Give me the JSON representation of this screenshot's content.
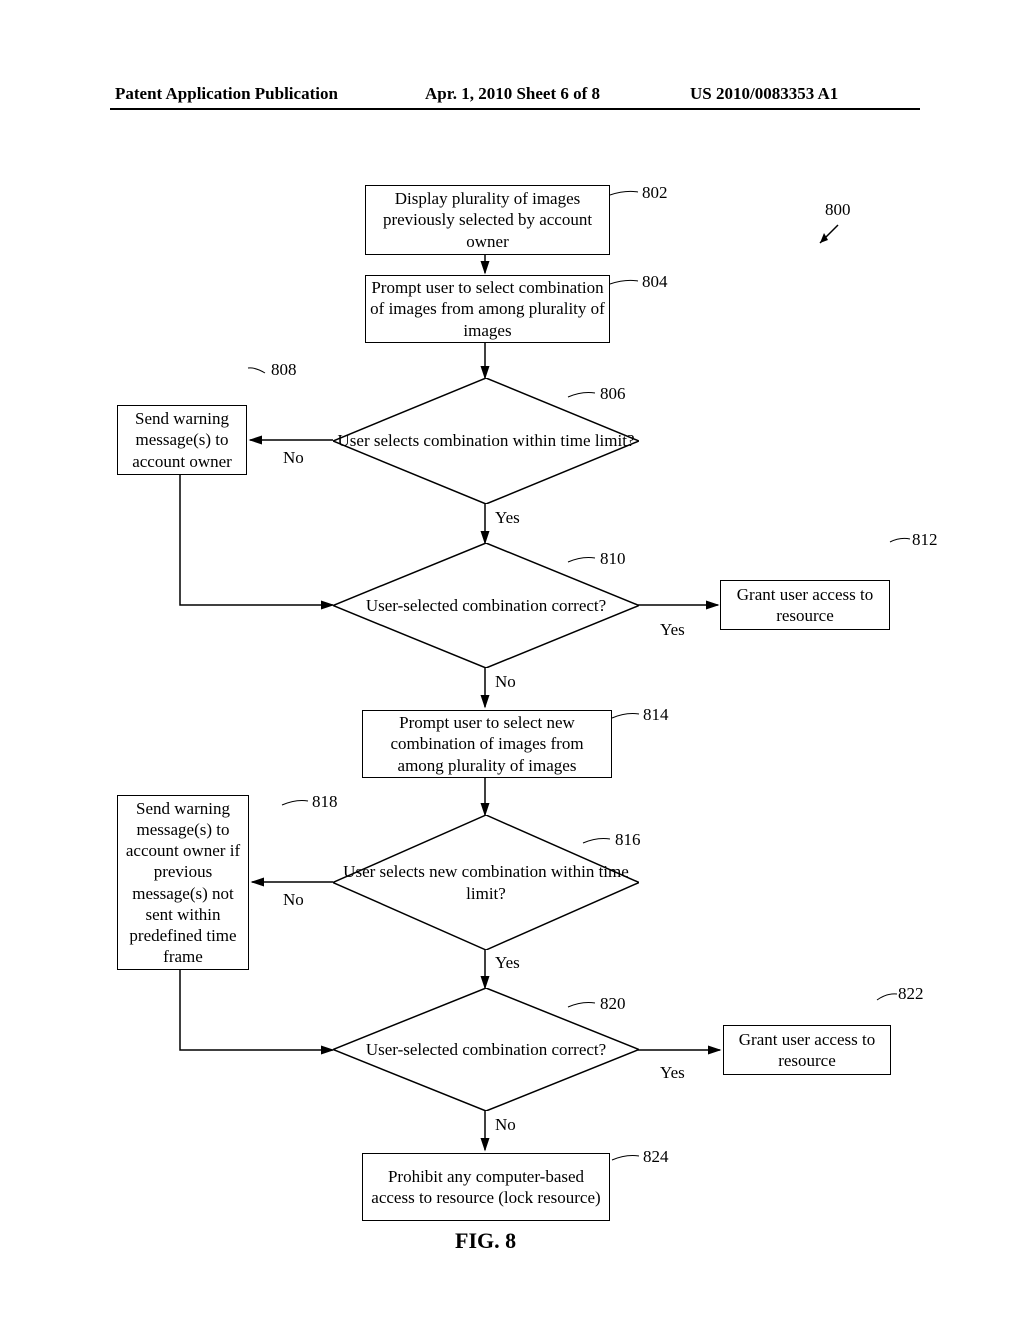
{
  "header": {
    "left": "Patent Application Publication",
    "center": "Apr. 1, 2010  Sheet 6 of 8",
    "right": "US 2010/0083353 A1"
  },
  "refs": {
    "r800": "800",
    "r802": "802",
    "r804": "804",
    "r806": "806",
    "r808": "808",
    "r810": "810",
    "r812": "812",
    "r814": "814",
    "r816": "816",
    "r818": "818",
    "r820": "820",
    "r822": "822",
    "r824": "824"
  },
  "boxes": {
    "b802": "Display plurality of images previously selected by account owner",
    "b804": "Prompt user to select combination of images from among plurality of images",
    "b808": "Send warning message(s) to account owner",
    "b812": "Grant user access to resource",
    "b814": "Prompt user to select new combination of images from among plurality of images",
    "b818": "Send warning message(s) to account owner if previous message(s) not sent within predefined time frame",
    "b822": "Grant user access to resource",
    "b824": "Prohibit any computer-based access to resource (lock resource)"
  },
  "diamonds": {
    "d806": "User selects combination within time limit?",
    "d810": "User-selected combination correct?",
    "d816": "User selects new combination within time limit?",
    "d820": "User-selected combination correct?"
  },
  "labels": {
    "no": "No",
    "yes": "Yes"
  },
  "figure": "FIG. 8"
}
